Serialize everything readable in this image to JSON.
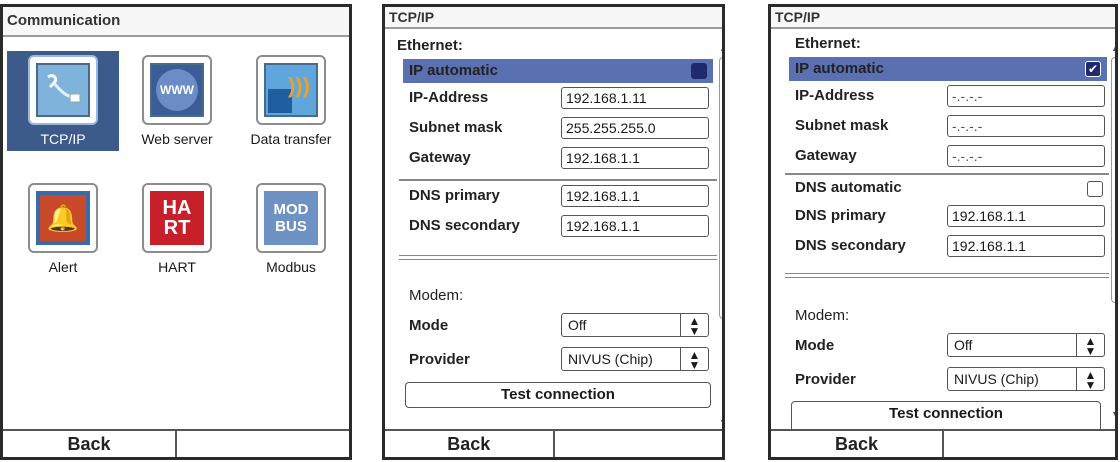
{
  "screen1": {
    "title": "Communication",
    "tiles": [
      {
        "label": "TCP/IP",
        "icon": "network-cable-icon"
      },
      {
        "label": "Web server",
        "icon": "www-globe-icon"
      },
      {
        "label": "Data transfer",
        "icon": "data-transfer-icon"
      },
      {
        "label": "Alert",
        "icon": "alert-bell-icon"
      },
      {
        "label": "HART",
        "icon": "hart-logo-icon"
      },
      {
        "label": "Modbus",
        "icon": "modbus-logo-icon"
      }
    ],
    "modbus_text": [
      "MOD",
      "BUS"
    ],
    "hart_text": [
      "HA",
      "RT"
    ],
    "www_text": "WWW",
    "footer": {
      "back": "Back",
      "right": ""
    }
  },
  "screen2": {
    "title": "TCP/IP",
    "ethernet": "Ethernet:",
    "ip_automatic": "IP automatic",
    "ip_address_label": "IP-Address",
    "ip_address": "192.168.1.11",
    "subnet_label": "Subnet mask",
    "subnet": "255.255.255.0",
    "gateway_label": "Gateway",
    "gateway": "192.168.1.1",
    "dns_primary_label": "DNS primary",
    "dns_primary": "192.168.1.1",
    "dns_secondary_label": "DNS secondary",
    "dns_secondary": "192.168.1.1",
    "modem": "Modem:",
    "mode_label": "Mode",
    "mode": "Off",
    "provider_label": "Provider",
    "provider": "NIVUS (Chip)",
    "test": "Test connection",
    "footer": {
      "back": "Back",
      "right": ""
    }
  },
  "screen3": {
    "title": "TCP/IP",
    "ethernet": "Ethernet:",
    "ip_automatic": "IP automatic",
    "ip_address_label": "IP-Address",
    "ip_address": "-.-.-.-",
    "subnet_label": "Subnet mask",
    "subnet": "-.-.-.-",
    "gateway_label": "Gateway",
    "gateway": "-.-.-.-",
    "dns_automatic_label": "DNS automatic",
    "dns_primary_label": "DNS primary",
    "dns_primary": "192.168.1.1",
    "dns_secondary_label": "DNS secondary",
    "dns_secondary": "192.168.1.1",
    "modem": "Modem:",
    "mode_label": "Mode",
    "mode": "Off",
    "provider_label": "Provider",
    "provider": "NIVUS (Chip)",
    "test": "Test connection",
    "footer": {
      "back": "Back",
      "right": ""
    }
  },
  "colors": {
    "highlight": "#5b70b0",
    "selected_tile": "#3c5a8a",
    "checkbox_fill": "#1f2a6e"
  }
}
